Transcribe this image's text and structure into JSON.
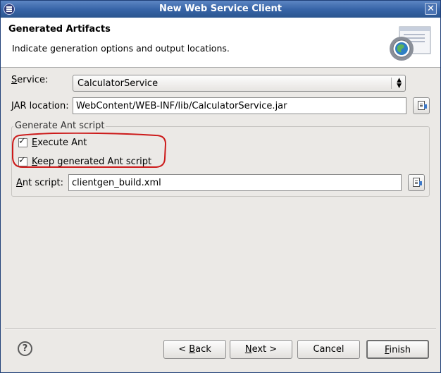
{
  "window": {
    "title": "New Web Service Client"
  },
  "header": {
    "title": "Generated Artifacts",
    "description": "Indicate generation options and output locations."
  },
  "service": {
    "label_first": "S",
    "label_rest": "ervice:",
    "value": "CalculatorService"
  },
  "jar": {
    "label_first": "J",
    "label_rest": "AR location:",
    "value": "WebContent/WEB-INF/lib/CalculatorService.jar"
  },
  "ant_group": {
    "label": "Generate Ant script",
    "execute": {
      "label_first": "E",
      "label_rest": "xecute Ant",
      "checked": true
    },
    "keep": {
      "label_first": "K",
      "label_rest": "eep generated Ant script",
      "checked": true
    },
    "script": {
      "label_first": "A",
      "label_rest": "nt script:",
      "value": "clientgen_build.xml"
    }
  },
  "buttons": {
    "back_prefix": "< ",
    "back_mn": "B",
    "back_rest": "ack",
    "next_mn": "N",
    "next_rest": "ext >",
    "cancel": "Cancel",
    "finish_mn": "F",
    "finish_rest": "inish"
  },
  "icons": {
    "close": "close-icon",
    "help": "help-icon",
    "browse": "browse-file-icon"
  },
  "colors": {
    "title_bar": "#3865a8",
    "highlight": "#cc1a1a",
    "dialog_bg": "#ebe9e6"
  }
}
